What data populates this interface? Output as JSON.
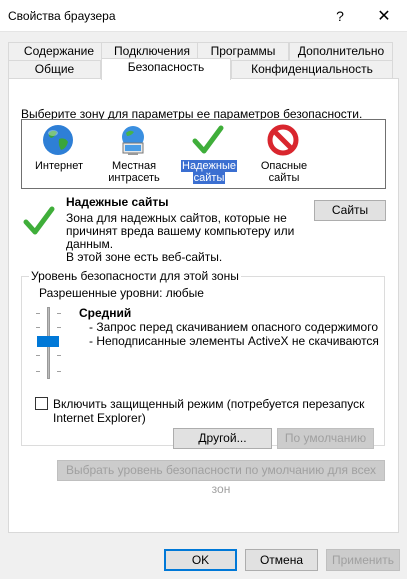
{
  "window": {
    "title": "Свойства браузера",
    "help": "?",
    "close": "✕"
  },
  "tabs": {
    "row1": [
      "Содержание",
      "Подключения",
      "Программы",
      "Дополнительно"
    ],
    "row2": [
      "Общие",
      "Безопасность",
      "Конфиденциальность"
    ],
    "active": "Безопасность"
  },
  "security": {
    "zone_prompt": "Выберите зону для параметры ее параметров безопасности.",
    "zones": [
      {
        "label_line1": "Интернет",
        "label_line2": "",
        "icon": "globe-icon"
      },
      {
        "label_line1": "Местная",
        "label_line2": "интрасеть",
        "icon": "intranet-icon"
      },
      {
        "label_line1": "Надежные",
        "label_line2": "сайты",
        "icon": "checkmark-icon",
        "selected": true
      },
      {
        "label_line1": "Опасные",
        "label_line2": "сайты",
        "icon": "restricted-icon"
      }
    ],
    "zone_title": "Надежные сайты",
    "zone_desc_1": "Зона для надежных сайтов, которые не",
    "zone_desc_2": "причинят вреда вашему компьютеру или",
    "zone_desc_3": "данным.",
    "zone_desc_4": "В этой зоне есть веб-сайты.",
    "sites_button": "Сайты",
    "level_group_title": "Уровень безопасности для этой зоны",
    "allowed_levels": "Разрешенные уровни: любые",
    "level_name": "Средний",
    "level_bullet_1": "- Запрос перед скачиванием опасного содержимого",
    "level_bullet_2": "- Неподписанные элементы ActiveX не скачиваются",
    "protected_mode_line1": "Включить защищенный режим (потребуется перезапуск",
    "protected_mode_line2": "Internet Explorer)",
    "protected_mode_checked": false,
    "custom_button": "Другой...",
    "default_button": "По умолчанию",
    "reset_all_button": "Выбрать уровень безопасности по умолчанию для всех зон"
  },
  "footer": {
    "ok": "OK",
    "cancel": "Отмена",
    "apply": "Применить"
  },
  "colors": {
    "selection": "#3b6fd1",
    "slider": "#0078d7",
    "check_green": "#3fae3a",
    "restricted_red": "#d9262e"
  }
}
